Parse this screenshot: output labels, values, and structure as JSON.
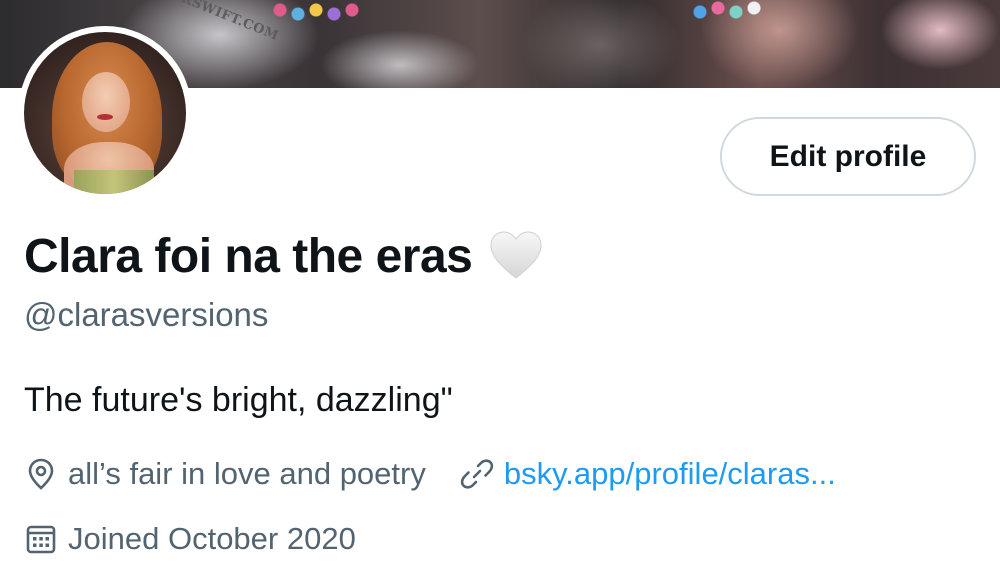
{
  "banner": {
    "band_text": "RSWIFT.COM"
  },
  "header": {
    "edit_profile_label": "Edit profile"
  },
  "profile": {
    "display_name": "Clara foi na the eras",
    "name_emoji": "white-heart-icon",
    "handle": "@clarasversions",
    "bio": "The future's bright, dazzling\"",
    "location": "all’s fair in love and poetry",
    "website": "bsky.app/profile/claras...",
    "joined": "Joined October 2020"
  },
  "icons": {
    "location": "location-pin-icon",
    "link": "link-icon",
    "calendar": "calendar-icon"
  },
  "colors": {
    "primary_text": "#0f1419",
    "secondary_text": "#536471",
    "link": "#1d9bf0",
    "button_border": "#cfd9de"
  }
}
